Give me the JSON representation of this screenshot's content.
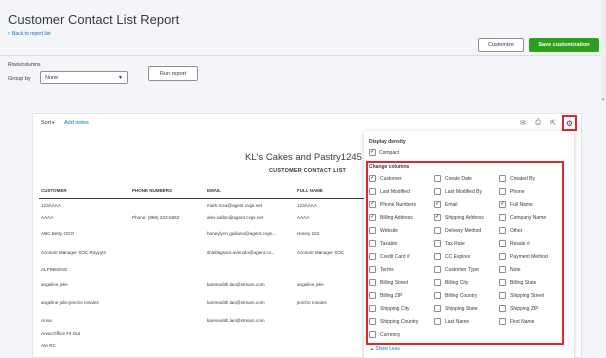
{
  "header": {
    "title": "Customer Contact List Report",
    "back_link": "Back to report list",
    "customize_label": "Customize",
    "save_label": "Save customization",
    "rows_columns_label": "Rows/columns",
    "groupby_label": "Group by",
    "groupby_value": "None",
    "run_report_label": "Run report"
  },
  "toolbar": {
    "sort_label": "Sort",
    "add_notes_label": "Add notes",
    "icons": [
      "email-icon",
      "print-icon",
      "export-icon",
      "gear-icon"
    ]
  },
  "report": {
    "company": "KL's Cakes and Pastry1245",
    "title": "CUSTOMER CONTACT LIST",
    "columns": [
      "CUSTOMER",
      "PHONE NUMBERS",
      "EMAIL",
      "FULL NAME"
    ],
    "rows": [
      [
        "123AAAA",
        "",
        "mark.roca@agent.cvgs.net",
        "123AAAA"
      ],
      [
        "AAAA",
        "Phone: (866) 223-5562",
        "alex.vallon@agent.cvgs.net",
        "AAAA"
      ],
      [
        "ABC Betty OGO",
        "",
        "honeylynn.guiliano@agent.cvgs...",
        "Honey 222"
      ],
      [
        "Account Manager SOC Rayyyts",
        "",
        "shiellagrace.avenido@agent.cv...",
        "Account Manager SOC"
      ],
      [
        "ALPINEENG",
        "",
        "",
        ""
      ],
      [
        "angeline jolie",
        "",
        "karenedith.lao@stream.com",
        "angeline jolie"
      ],
      [
        "angeline jolie:jericho rosales",
        "",
        "karenedith.lao@stream.com",
        "jericho rosales"
      ],
      [
        "Anna",
        "",
        "karenedith.lao@stream.com",
        "Anna"
      ],
      [
        "Anna:Office Fit Out",
        "",
        "",
        ""
      ],
      [
        "Ate RC",
        "",
        "",
        ""
      ]
    ]
  },
  "settings": {
    "display_density_label": "Display density",
    "compact_label": "Compact",
    "compact_checked": true,
    "change_columns_label": "Change columns",
    "options": [
      {
        "label": "Customer",
        "checked": true
      },
      {
        "label": "Create Date",
        "checked": false
      },
      {
        "label": "Created By",
        "checked": false
      },
      {
        "label": "Last Modified",
        "checked": false
      },
      {
        "label": "Last Modified By",
        "checked": false
      },
      {
        "label": "Phone",
        "checked": false
      },
      {
        "label": "Phone Numbers",
        "checked": true
      },
      {
        "label": "Email",
        "checked": true
      },
      {
        "label": "Full Name",
        "checked": true
      },
      {
        "label": "Billing Address",
        "checked": true
      },
      {
        "label": "Shipping Address",
        "checked": true
      },
      {
        "label": "Company Name",
        "checked": false
      },
      {
        "label": "Website",
        "checked": false
      },
      {
        "label": "Delivery Method",
        "checked": false
      },
      {
        "label": "Other",
        "checked": false
      },
      {
        "label": "Taxable",
        "checked": false
      },
      {
        "label": "Tax Rate",
        "checked": false
      },
      {
        "label": "Resale #",
        "checked": false
      },
      {
        "label": "Credit Card #",
        "checked": false
      },
      {
        "label": "CC Expires",
        "checked": false
      },
      {
        "label": "Payment Method",
        "checked": false
      },
      {
        "label": "Terms",
        "checked": false
      },
      {
        "label": "Customer Type",
        "checked": false
      },
      {
        "label": "Note",
        "checked": false
      },
      {
        "label": "Billing Street",
        "checked": false
      },
      {
        "label": "Billing City",
        "checked": false
      },
      {
        "label": "Billing State",
        "checked": false
      },
      {
        "label": "Billing ZIP",
        "checked": false
      },
      {
        "label": "Billing Country",
        "checked": false
      },
      {
        "label": "Shipping Street",
        "checked": false
      },
      {
        "label": "Shipping City",
        "checked": false
      },
      {
        "label": "Shipping State",
        "checked": false
      },
      {
        "label": "Shipping ZIP",
        "checked": false
      },
      {
        "label": "Shipping Country",
        "checked": false
      },
      {
        "label": "Last Name",
        "checked": false
      },
      {
        "label": "First Name",
        "checked": false
      },
      {
        "label": "Currency",
        "checked": false
      }
    ],
    "show_less_label": "Show Less"
  },
  "colors": {
    "accent_green": "#2ca01c",
    "link_blue": "#0077c5",
    "highlight_red": "#e0272f"
  }
}
